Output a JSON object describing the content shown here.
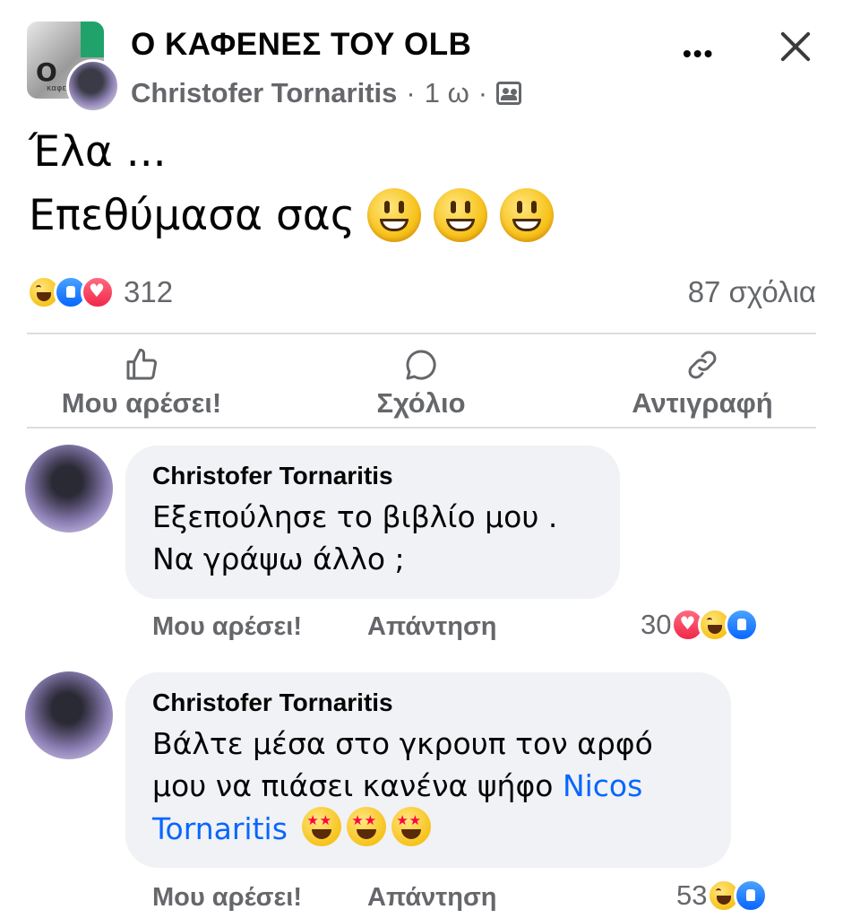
{
  "header": {
    "group_name": "Ο ΚΑΦΕΝΕΣ ΤΟΥ OLB",
    "author": "Christofer Tornaritis",
    "time": "1 ω",
    "dot": "·",
    "privacy_icon": "group-members-icon"
  },
  "post": {
    "line1": "Έλα ...",
    "line2": "Επεθύμασα σας",
    "emojis": [
      "grinning-face",
      "grinning-face",
      "grinning-face"
    ]
  },
  "stats": {
    "reaction_icons": [
      "haha",
      "like",
      "love"
    ],
    "reaction_count": "312",
    "comments_count": "87 σχόλια"
  },
  "actions": {
    "like": "Μου αρέσει!",
    "comment": "Σχόλιο",
    "copy": "Αντιγραφή"
  },
  "comments": [
    {
      "author": "Christofer Tornaritis",
      "line1": "Εξεπούλησε το βιβλίο μου .",
      "line2": "Να γράψω άλλο ;",
      "like": "Μου αρέσει!",
      "reply": "Απάντηση",
      "reaction_count": "30",
      "reaction_icons": [
        "love",
        "haha",
        "like"
      ]
    },
    {
      "author": "Christofer Tornaritis",
      "line1": "Βάλτε μέσα στο γκρουπ τον αρφό",
      "line2": "μου να πιάσει κανένα ψήφο",
      "mention_part1": "Nicos",
      "mention_part2": "Tornaritis",
      "emojis": [
        "star-struck",
        "star-struck",
        "star-struck"
      ],
      "like": "Μου αρέσει!",
      "reply": "Απάντηση",
      "reaction_count": "53",
      "reaction_icons": [
        "haha",
        "like"
      ]
    }
  ],
  "colors": {
    "link": "#0866ff",
    "secondary_text": "#65676b",
    "bubble": "#f0f2f5"
  }
}
